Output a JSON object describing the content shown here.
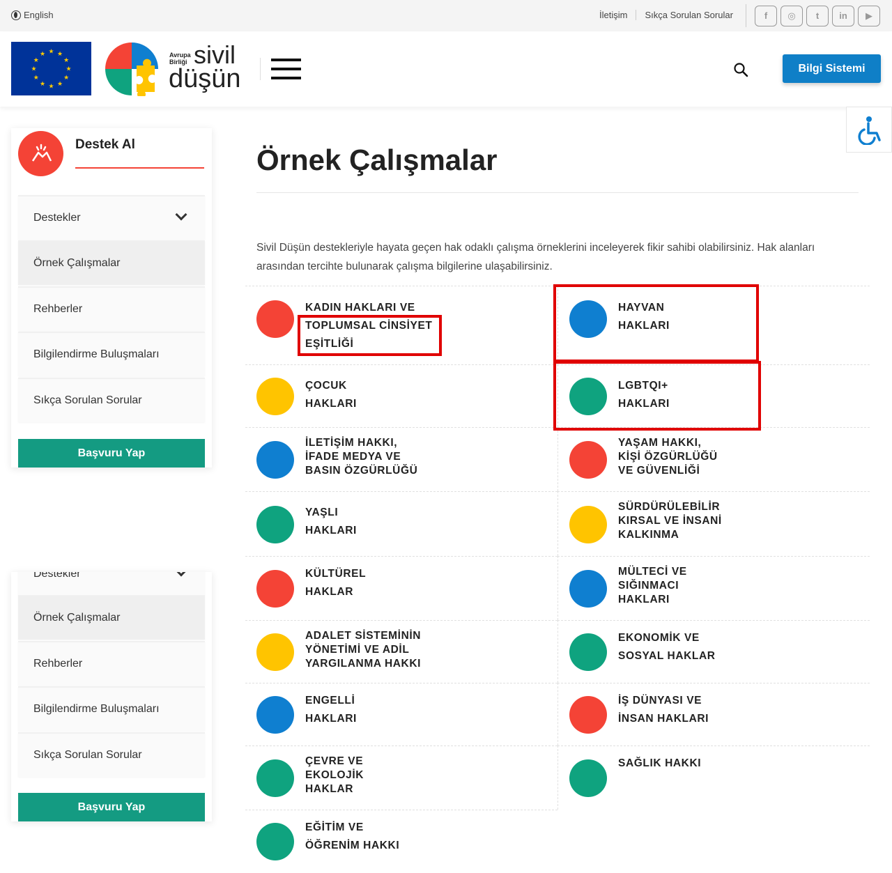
{
  "topbar": {
    "language": "English",
    "links": [
      "İletişim",
      "Sıkça Sorulan Sorular"
    ],
    "socials": [
      {
        "icon": "facebook-icon",
        "glyph": "f"
      },
      {
        "icon": "instagram-icon",
        "glyph": "◎"
      },
      {
        "icon": "twitter-icon",
        "glyph": "t"
      },
      {
        "icon": "linkedin-icon",
        "glyph": "in"
      },
      {
        "icon": "youtube-icon",
        "glyph": "▶"
      }
    ]
  },
  "header": {
    "brand_small": "Avrupa Birliği",
    "brand_sivil": "sivil",
    "brand_dusun": "düşün",
    "cta_label": "Bilgi Sistemi"
  },
  "sidebar": {
    "title": "Destek Al",
    "items": [
      {
        "label": "Destekler",
        "has_chevron": true,
        "active": false
      },
      {
        "label": "Örnek Çalışmalar",
        "has_chevron": false,
        "active": true
      },
      {
        "label": "Rehberler",
        "has_chevron": false,
        "active": false
      },
      {
        "label": "Bilgilendirme Buluşmaları",
        "has_chevron": false,
        "active": false
      },
      {
        "label": "Sıkça Sorulan Sorular",
        "has_chevron": false,
        "active": false
      }
    ],
    "apply_label": "Başvuru Yap"
  },
  "main": {
    "title": "Örnek Çalışmalar",
    "intro": "Sivil Düşün destekleriyle hayata geçen hak odaklı çalışma örneklerini inceleyerek fikir sahibi olabilirsiniz. Hak alanları arasından tercihte bulunarak çalışma bilgilerine ulaşabilirsiniz."
  },
  "colors": {
    "red": "#f44336",
    "blue": "#0f7fd0",
    "yellow": "#ffc400",
    "green": "#0fa37f",
    "eu_blue": "#003399",
    "eu_gold": "#ffcc00",
    "cta_blue": "#0f7fc7",
    "apply_green": "#149b82",
    "annotation_red": "#e00000"
  },
  "categories": [
    {
      "color": "red",
      "lines": [
        "KADIN HAKLARI VE",
        "TOPLUMSAL CİNSİYET",
        "EŞİTLİĞİ"
      ]
    },
    {
      "color": "blue",
      "lines": [
        "HAYVAN",
        "HAKLARI"
      ]
    },
    {
      "color": "yellow",
      "lines": [
        "ÇOCUK",
        "HAKLARI"
      ]
    },
    {
      "color": "green",
      "lines": [
        "LGBTQI+",
        "HAKLARI"
      ]
    },
    {
      "color": "blue",
      "lines": [
        "İLETİŞİM HAKKI,",
        "İFADE MEDYA VE",
        "BASIN ÖZGÜRLÜĞÜ"
      ]
    },
    {
      "color": "red",
      "lines": [
        "YAŞAM HAKKI,",
        "KİŞİ ÖZGÜRLÜĞÜ",
        "VE GÜVENLİĞİ"
      ]
    },
    {
      "color": "green",
      "lines": [
        "YAŞLI",
        "HAKLARI"
      ]
    },
    {
      "color": "yellow",
      "lines": [
        "SÜRDÜRÜLEBİLİR",
        "KIRSAL VE İNSANİ",
        "KALKINMA"
      ]
    },
    {
      "color": "red",
      "lines": [
        "KÜLTÜREL",
        "HAKLAR"
      ]
    },
    {
      "color": "blue",
      "lines": [
        "MÜLTECİ VE",
        "SIĞINMACI",
        "HAKLARI"
      ]
    },
    {
      "color": "yellow",
      "lines": [
        "ADALET SİSTEMİNİN",
        "YÖNETİMİ VE ADİL",
        "YARGILANMA HAKKI"
      ]
    },
    {
      "color": "green",
      "lines": [
        "EKONOMİK VE",
        "SOSYAL HAKLAR"
      ]
    },
    {
      "color": "blue",
      "lines": [
        "ENGELLİ",
        "HAKLARI"
      ]
    },
    {
      "color": "red",
      "lines": [
        "İŞ DÜNYASI VE",
        "İNSAN HAKLARI"
      ]
    },
    {
      "color": "green",
      "lines": [
        "ÇEVRE VE",
        "EKOLOJİK",
        "HAKLAR"
      ]
    },
    {
      "color": "green",
      "lines": [
        "SAĞLIK HAKKI"
      ]
    },
    {
      "color": "green",
      "lines": [
        "EĞİTİM VE",
        "ÖĞRENİM HAKKI"
      ]
    }
  ]
}
